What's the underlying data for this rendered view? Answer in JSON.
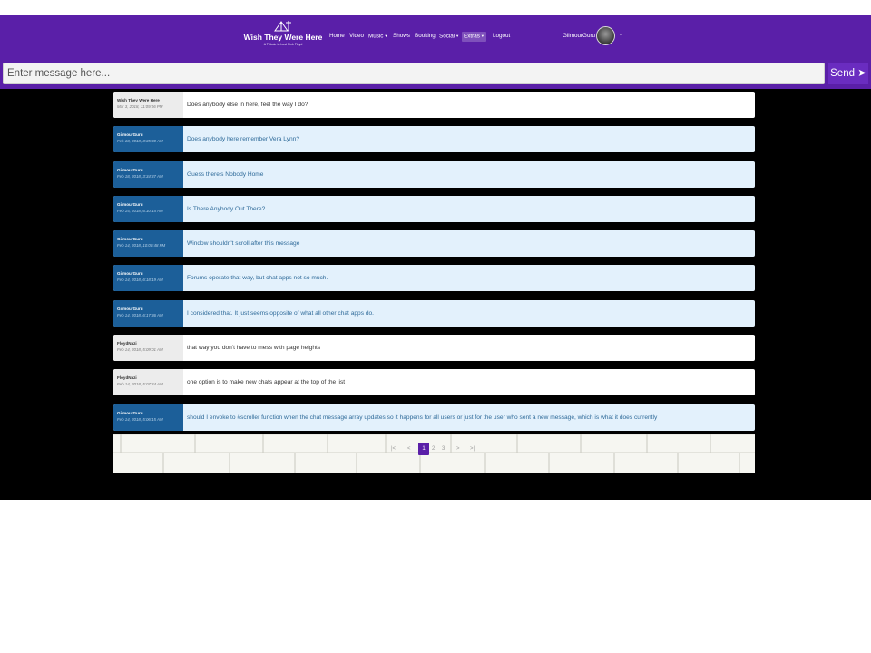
{
  "navbar": {
    "brand_title": "Wish They Were Here",
    "brand_tagline": "A Tribute to Lost Pink Floyd",
    "items": [
      {
        "label": "Home"
      },
      {
        "label": "Video"
      },
      {
        "label": "Music",
        "dropdown": true
      },
      {
        "label": "Shows"
      },
      {
        "label": "Booking"
      },
      {
        "label": "Social",
        "dropdown": true
      },
      {
        "label": "Extras",
        "dropdown": true,
        "active": true
      },
      {
        "label": "Logout"
      }
    ],
    "user_name": "GilmourGuru",
    "icons": [
      "logo-icon",
      "avatar",
      "caret-down-icon"
    ]
  },
  "composer": {
    "placeholder": "Enter message here...",
    "value": "",
    "send_label": "Send ➤"
  },
  "messages": [
    {
      "author": "Wish They Were Here",
      "time": "Mar 3, 2018, 11:09:06 PM",
      "text": "Does anybody else in here, feel the way I do?",
      "own": false
    },
    {
      "author": "GilmourGuru",
      "time": "Feb 18, 2018, 3:35:00 AM",
      "text": "Does anybody here remember Vera Lynn?",
      "own": true
    },
    {
      "author": "GilmourGuru",
      "time": "Feb 18, 2018, 3:34:37 AM",
      "text": "Guess there's Nobody Home",
      "own": true
    },
    {
      "author": "GilmourGuru",
      "time": "Feb 15, 2018, 6:10:14 AM",
      "text": "Is There Anybody Out There?",
      "own": true
    },
    {
      "author": "GilmourGuru",
      "time": "Feb 14, 2018, 10:00:48 PM",
      "text": "Window shouldn't scroll after this message",
      "own": true
    },
    {
      "author": "GilmourGuru",
      "time": "Feb 14, 2018, 6:18:19 AM",
      "text": "Forums operate that way, but chat apps not so much.",
      "own": true
    },
    {
      "author": "GilmourGuru",
      "time": "Feb 14, 2018, 6:17:36 AM",
      "text": "I considered that. It just seems opposite of what all other chat apps do.",
      "own": true
    },
    {
      "author": "FloydNazi",
      "time": "Feb 14, 2018, 5:09:01 AM",
      "text": "that way you don't have to mess with page heights",
      "own": false
    },
    {
      "author": "FloydNazi",
      "time": "Feb 14, 2018, 5:07:44 AM",
      "text": "one option is to make new chats appear at the top of the list",
      "own": false
    },
    {
      "author": "GilmourGuru",
      "time": "Feb 14, 2018, 5:06:15 AM",
      "text": "should I envoke to #scroller function when the chat message array updates so it happens for all users or just for the user who sent a new message, which is what it does currently",
      "own": true
    }
  ],
  "pagination": {
    "first": "|<",
    "prev": "<",
    "pages": [
      "1",
      "2",
      "3"
    ],
    "current": "1",
    "next": ">",
    "last": ">|"
  },
  "colors": {
    "header": "#5a1fa8",
    "own_meta": "#1c5f99",
    "own_bg": "#e3f1fc",
    "other_meta": "#ececec",
    "chat_bg": "#000000"
  }
}
